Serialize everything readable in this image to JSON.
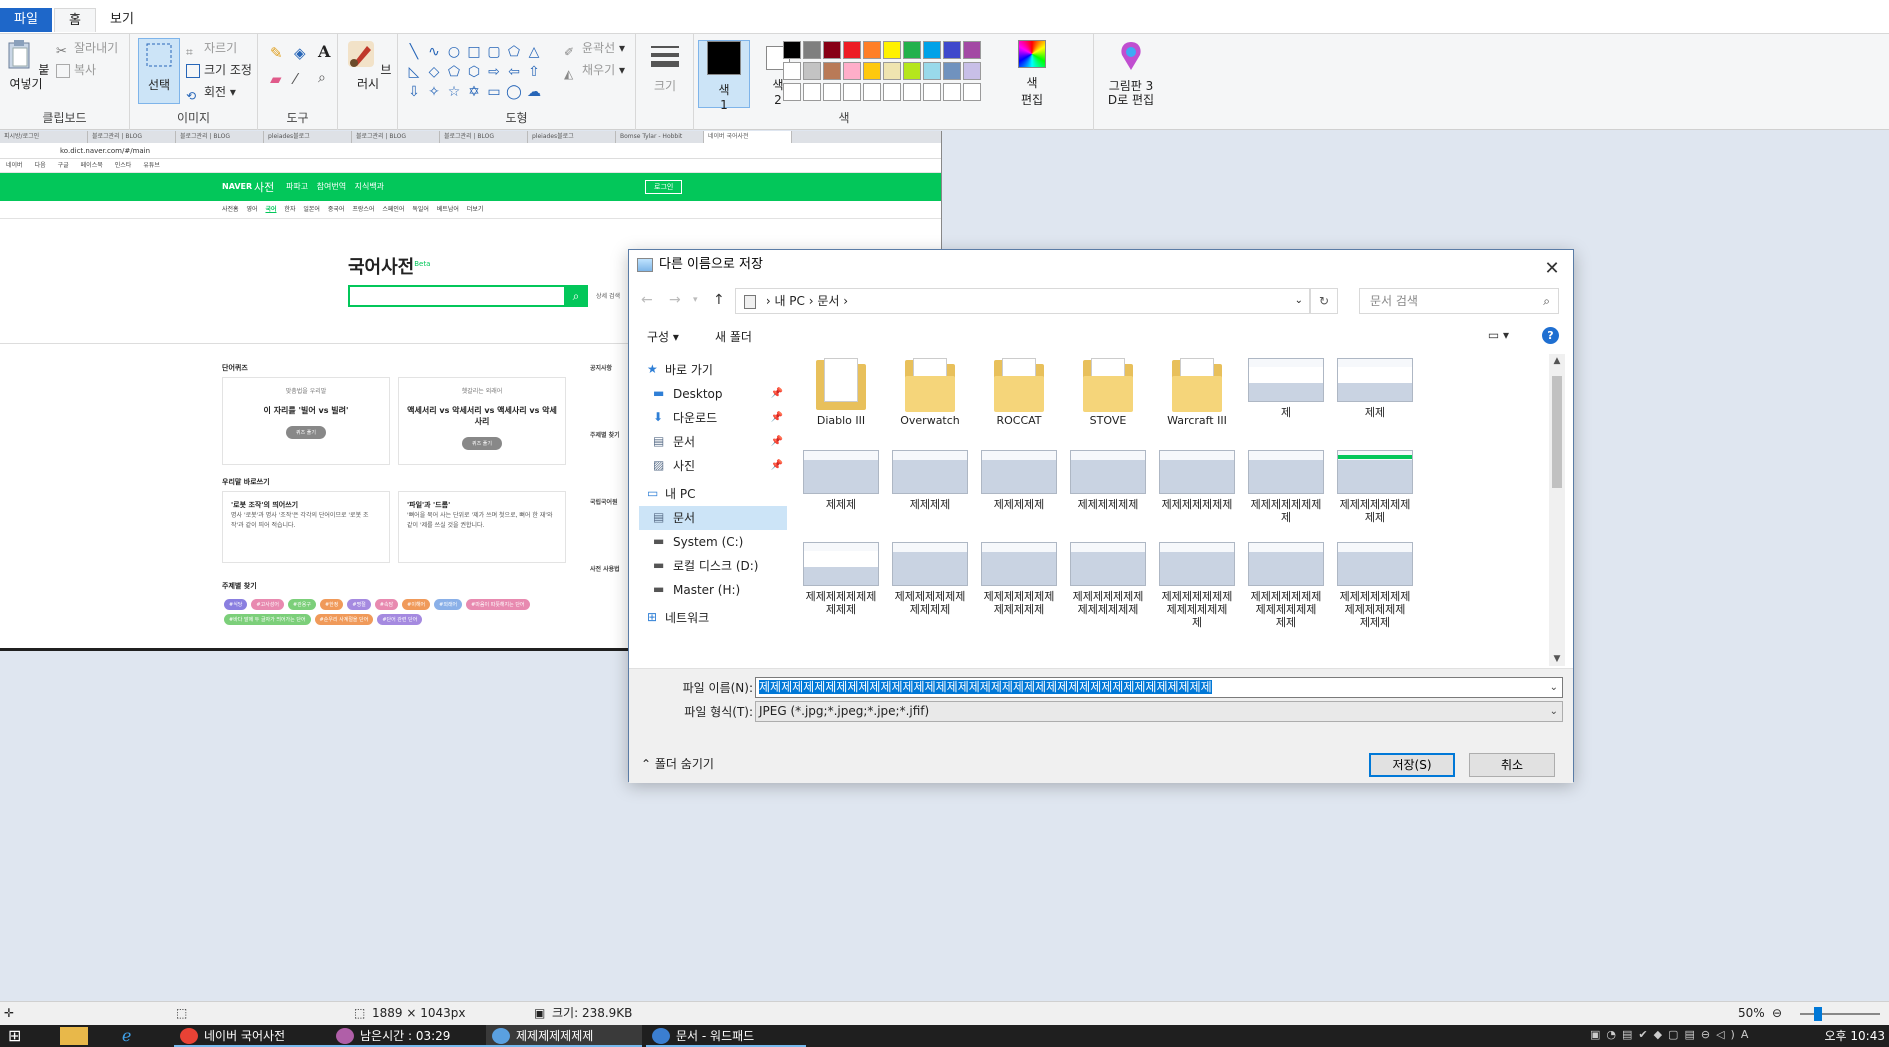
{
  "ribbon": {
    "tabs": [
      "파일",
      "홈",
      "보기"
    ],
    "clipboard": {
      "paste": "붙여넣기",
      "cut": "잘라내기",
      "copy": "복사",
      "label": "클립보드"
    },
    "image": {
      "select": "선택",
      "crop": "자르기",
      "resize": "크기 조정",
      "rotate": "회전",
      "label": "이미지"
    },
    "tools": {
      "label": "도구"
    },
    "brushes": {
      "label": "브러시"
    },
    "shapes": {
      "outline": "윤곽선",
      "fill": "채우기",
      "label": "도형"
    },
    "size": {
      "label": "크기"
    },
    "colors": {
      "color1": "색\n1",
      "color1_a": "색",
      "color1_b": "1",
      "color2_a": "색",
      "color2_b": "2",
      "edit_a": "색",
      "edit_b": "편집",
      "label": "색",
      "palette": [
        "#000000",
        "#7f7f7f",
        "#880015",
        "#ed1c24",
        "#ff7f27",
        "#fff200",
        "#22b14c",
        "#00a2e8",
        "#3f48cc",
        "#a349a4",
        "#ffffff",
        "#c3c3c3",
        "#b97a57",
        "#ffaec9",
        "#ffc90e",
        "#efe4b0",
        "#b5e61d",
        "#99d9ea",
        "#7092be",
        "#c8bfe7",
        "#ffffff",
        "#ffffff",
        "#ffffff",
        "#ffffff",
        "#ffffff",
        "#ffffff",
        "#ffffff",
        "#ffffff",
        "#ffffff",
        "#ffffff"
      ]
    },
    "paint3d_a": "그림판 3",
    "paint3d_b": "D로 편집"
  },
  "pasted": {
    "address": "ko.dict.naver.com/#/main",
    "bookmarks": [
      "네이버",
      "다음",
      "구글",
      "페이스북",
      "인스타",
      "유튜브"
    ],
    "naver_logo": "NAVER",
    "dict_title": "사전",
    "nav": "파파고  참여번역  지식백과",
    "login": "로그인",
    "menu": [
      "사전홈",
      "영어",
      "국어",
      "한자",
      "일본어",
      "중국어",
      "프랑스어",
      "스페인어",
      "독일어",
      "베트남어",
      "더보기"
    ],
    "menu_active": "국어",
    "kor_title": "국어사전",
    "beta": "Beta",
    "detail": "상세 검색",
    "quiz_title": "단어퀴즈",
    "quiz1_small": "맞춤법을 우리말",
    "quiz1_q": "이 자리를 '빌어 vs 빌려'",
    "quiz2_small": "헷갈리는 외래어",
    "quiz2_q": "액세서리 vs 악세서리 vs 액세사리 vs 악세사리",
    "quiz_btn": "퀴즈 풀기",
    "fix_title": "우리말 바로쓰기",
    "fix1_h": "'로봇 조작'의 띄어쓰기",
    "fix1_t": "명사 '로봇'과 명사 '조작'은 각각의 단어이므로 '로봇 조작'과 같이 띄어 적습니다.",
    "fix2_h": "'파일'과 '드롬'",
    "fix2_t": "'뻐어을 묵어 사는 단위로 '제가 쓰며 첫으로, 뼈어 한 재'와 같이 '제를 쓰실 것을 권합니다.",
    "topic_title": "주제별 찾기",
    "tags": [
      {
        "t": "#식당",
        "c": "#8a7fe0"
      },
      {
        "t": "#고사성어",
        "c": "#e88ab0"
      },
      {
        "t": "#관용구",
        "c": "#7ccf7a"
      },
      {
        "t": "#한정",
        "c": "#f09a5a"
      },
      {
        "t": "#명절",
        "c": "#a58ae0"
      },
      {
        "t": "#속담",
        "c": "#e88ab0"
      },
      {
        "t": "#이해어",
        "c": "#f09a5a"
      },
      {
        "t": "#외래어",
        "c": "#8ab0e8"
      },
      {
        "t": "#마음이 따뜻해지는 단어",
        "c": "#e88ab0"
      },
      {
        "t": "#바다 말에 두 글자가 띄어가는 단어",
        "c": "#7ccf7a"
      },
      {
        "t": "#순우리 사계절을 단어",
        "c": "#f09a5a"
      },
      {
        "t": "#단어 관련 단어",
        "c": "#a58ae0"
      }
    ],
    "right_col": [
      "공지사항",
      "주제별 찾기",
      "국립국어원",
      "사전 사용법"
    ],
    "tabs": [
      "피시방/로그인",
      "블로그관리 | BLOG",
      "블로그관리 | BLOG",
      "pleiades블로그",
      "블로그관리 | BLOG",
      "블로그관리 | BLOG",
      "pleiades블로그",
      "Bomse Tylar - Hobbit",
      "네이버 국어사전"
    ]
  },
  "dialog": {
    "title": "다른 이름으로 저장",
    "path": [
      "내 PC",
      "문서"
    ],
    "search_placeholder": "문서 검색",
    "organize": "구성 ▾",
    "new_folder": "새 폴더",
    "nav": [
      {
        "label": "바로 가기",
        "type": "star",
        "top": true
      },
      {
        "label": "Desktop",
        "type": "desktop",
        "pin": true
      },
      {
        "label": "다운로드",
        "type": "download",
        "pin": true
      },
      {
        "label": "문서",
        "type": "doc",
        "pin": true
      },
      {
        "label": "사진",
        "type": "pic",
        "pin": true
      },
      {
        "label": "내 PC",
        "type": "pc",
        "top": true
      },
      {
        "label": "문서",
        "type": "doc",
        "sel": true
      },
      {
        "label": "System (C:)",
        "type": "drive"
      },
      {
        "label": "로컬 디스크 (D:)",
        "type": "drive"
      },
      {
        "label": "Master (H:)",
        "type": "drive"
      },
      {
        "label": "네트워크",
        "type": "net",
        "top": true
      }
    ],
    "items": [
      {
        "name": "Diablo III",
        "kind": "folder-doc"
      },
      {
        "name": "Overwatch",
        "kind": "folder"
      },
      {
        "name": "ROCCAT",
        "kind": "folder"
      },
      {
        "name": "STOVE",
        "kind": "folder"
      },
      {
        "name": "Warcraft III",
        "kind": "folder"
      },
      {
        "name": "제",
        "kind": "thumb-app"
      },
      {
        "name": "제제",
        "kind": "thumb-app"
      },
      {
        "name": "제제제",
        "kind": "thumb"
      },
      {
        "name": "제제제제",
        "kind": "thumb"
      },
      {
        "name": "제제제제제",
        "kind": "thumb"
      },
      {
        "name": "제제제제제제",
        "kind": "thumb"
      },
      {
        "name": "제제제제제제제",
        "kind": "thumb"
      },
      {
        "name": "제제제제제제제\n제",
        "kind": "thumb"
      },
      {
        "name": "제제제제제제제\n제제",
        "kind": "thumb-green"
      },
      {
        "name": "제제제제제제제\n제제제",
        "kind": "thumb-app"
      },
      {
        "name": "제제제제제제제\n제제제제",
        "kind": "thumb"
      },
      {
        "name": "제제제제제제제\n제제제제제",
        "kind": "thumb"
      },
      {
        "name": "제제제제제제제\n제제제제제제",
        "kind": "thumb"
      },
      {
        "name": "제제제제제제제\n제제제제제제\n제",
        "kind": "thumb"
      },
      {
        "name": "제제제제제제제\n제제제제제제\n제제",
        "kind": "thumb"
      },
      {
        "name": "제제제제제제제\n제제제제제제\n제제제",
        "kind": "thumb"
      }
    ],
    "filename_label": "파일 이름(N):",
    "filename_value": "제제제제제제제제제제제제제제제제제제제제제제제제제제제제제제제제제제제제제제제제제",
    "filetype_label": "파일 형식(T):",
    "filetype_value": "JPEG (*.jpg;*.jpeg;*.jpe;*.jfif)",
    "hide_folders": "폴더 숨기기",
    "save": "저장(S)",
    "cancel": "취소"
  },
  "status": {
    "dimensions": "1889 × 1043px",
    "size": "크기: 238.9KB",
    "zoom": "50%"
  },
  "taskbar": {
    "items": [
      {
        "label": "네이버 국어사전",
        "color": "#e94235"
      },
      {
        "label": "남은시간 : 03:29",
        "color": "#b05fa8"
      },
      {
        "label": "제제제제제제제",
        "color": "#5aa0e0",
        "active": true
      },
      {
        "label": "문서 - 워드패드",
        "color": "#3b7ed0"
      }
    ],
    "clock": "오후 10:43"
  }
}
